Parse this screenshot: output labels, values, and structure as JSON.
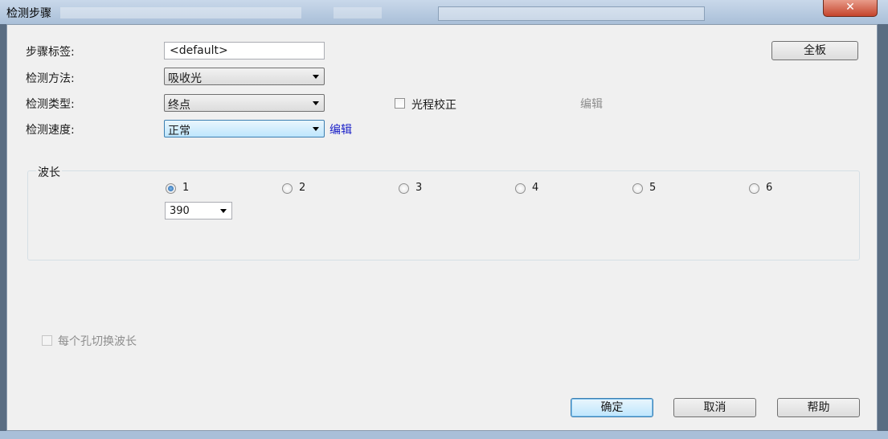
{
  "window": {
    "title": "检测步骤",
    "close_symbol": "✕"
  },
  "form": {
    "step_label": {
      "label": "步骤标签:",
      "value": "<default>"
    },
    "method": {
      "label": "检测方法:",
      "value": "吸收光"
    },
    "type": {
      "label": "检测类型:",
      "value": "终点"
    },
    "speed": {
      "label": "检测速度:",
      "value": "正常"
    },
    "pathcheck_label": "光程校正",
    "edit_disabled": "编辑",
    "edit_link": "编辑",
    "full_plate_button": "全板"
  },
  "wavelength": {
    "group_title": "波长",
    "options": [
      "1",
      "2",
      "3",
      "4",
      "5",
      "6"
    ],
    "selected": "1",
    "value": "390"
  },
  "per_well_switch_label": "每个孔切换波长",
  "footer": {
    "ok": "确定",
    "cancel": "取消",
    "help": "帮助"
  }
}
